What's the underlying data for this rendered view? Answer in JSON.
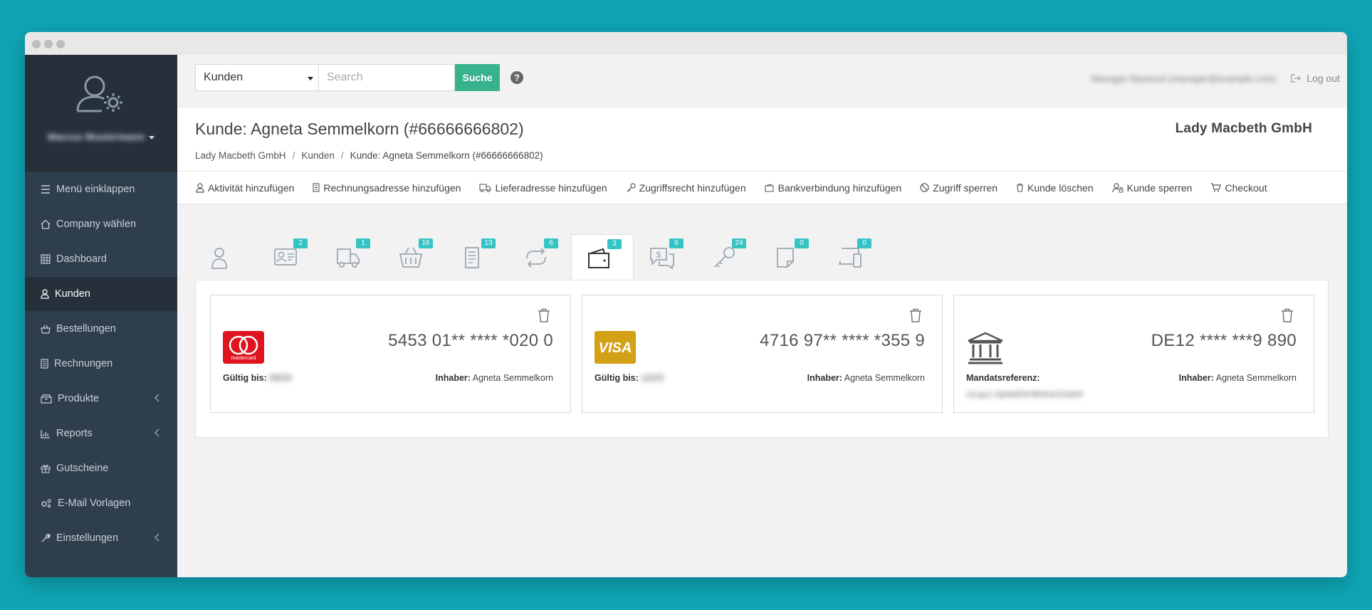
{
  "sidebar": {
    "user_name": "Marcus Mustermann",
    "items": [
      {
        "label": "Menü einklappen",
        "icon": "hamburger-icon"
      },
      {
        "label": "Company wählen",
        "icon": "home-icon"
      },
      {
        "label": "Dashboard",
        "icon": "grid-icon"
      },
      {
        "label": "Kunden",
        "icon": "user-icon",
        "active": true
      },
      {
        "label": "Bestellungen",
        "icon": "basket-icon"
      },
      {
        "label": "Rechnungen",
        "icon": "document-icon"
      },
      {
        "label": "Produkte",
        "icon": "box-icon",
        "has_submenu": true
      },
      {
        "label": "Reports",
        "icon": "chart-icon",
        "has_submenu": true
      },
      {
        "label": "Gutscheine",
        "icon": "gift-icon"
      },
      {
        "label": "E-Mail Vorlagen",
        "icon": "cogs-icon"
      },
      {
        "label": "Einstellungen",
        "icon": "wrench-icon",
        "has_submenu": true
      }
    ]
  },
  "topbar": {
    "select_value": "Kunden",
    "search_placeholder": "Search",
    "search_button": "Suche",
    "user_text": "Manager Backend (manager@example.com)",
    "logout_label": "Log out"
  },
  "header": {
    "title": "Kunde: Agneta Semmelkorn (#66666666802)",
    "company": "Lady Macbeth GmbH",
    "breadcrumb": [
      "Lady Macbeth GmbH",
      "Kunden",
      "Kunde: Agneta Semmelkorn (#66666666802)"
    ]
  },
  "actions": [
    {
      "label": "Aktivität hinzufügen",
      "icon": "user-activity-icon"
    },
    {
      "label": "Rechnungsadresse hinzufügen",
      "icon": "document-icon"
    },
    {
      "label": "Lieferadresse hinzufügen",
      "icon": "truck-icon"
    },
    {
      "label": "Zugriffsrecht hinzufügen",
      "icon": "key-icon"
    },
    {
      "label": "Bankverbindung hinzufügen",
      "icon": "wallet-icon"
    },
    {
      "label": "Zugriff sperren",
      "icon": "ban-icon"
    },
    {
      "label": "Kunde löschen",
      "icon": "trash-icon"
    },
    {
      "label": "Kunde sperren",
      "icon": "user-lock-icon"
    },
    {
      "label": "Checkout",
      "icon": "cart-icon"
    }
  ],
  "tabs": [
    {
      "icon": "user-icon",
      "badge": null
    },
    {
      "icon": "id-card-icon",
      "badge": "2"
    },
    {
      "icon": "truck-icon",
      "badge": "1"
    },
    {
      "icon": "basket-icon",
      "badge": "16"
    },
    {
      "icon": "invoice-icon",
      "badge": "13"
    },
    {
      "icon": "repeat-icon",
      "badge": "6"
    },
    {
      "icon": "wallet-icon",
      "badge": "3",
      "active": true
    },
    {
      "icon": "chat-money-icon",
      "badge": "6"
    },
    {
      "icon": "key-icon",
      "badge": "24"
    },
    {
      "icon": "note-icon",
      "badge": "0"
    },
    {
      "icon": "devices-icon",
      "badge": "0"
    }
  ],
  "payment_methods": [
    {
      "type": "mastercard",
      "number": "5453 01** **** *020 0",
      "left_label": "Gültig bis:",
      "left_value": "09/23",
      "holder_label": "Inhaber:",
      "holder": "Agneta Semmelkorn",
      "logo_text": "mastercard"
    },
    {
      "type": "visa",
      "number": "4716 97** **** *355 9",
      "left_label": "Gültig bis:",
      "left_value": "12/23",
      "holder_label": "Inhaber:",
      "holder": "Agneta Semmelkorn",
      "logo_text": "VISA"
    },
    {
      "type": "bank",
      "number": "DE12 **** ***9 890",
      "left_label": "Mandatsreferenz:",
      "left_value": "Ocap1-Hjd4dD5HBhfvkGNdtAf",
      "holder_label": "Inhaber:",
      "holder": "Agneta Semmelkorn"
    }
  ],
  "colors": {
    "background": "#0fa5b5",
    "sidebar": "#2f3e4c",
    "accent_green": "#38b28d",
    "badge": "#36c3c4",
    "mastercard_red": "#e0141e",
    "visa_gold": "#d4a016"
  }
}
